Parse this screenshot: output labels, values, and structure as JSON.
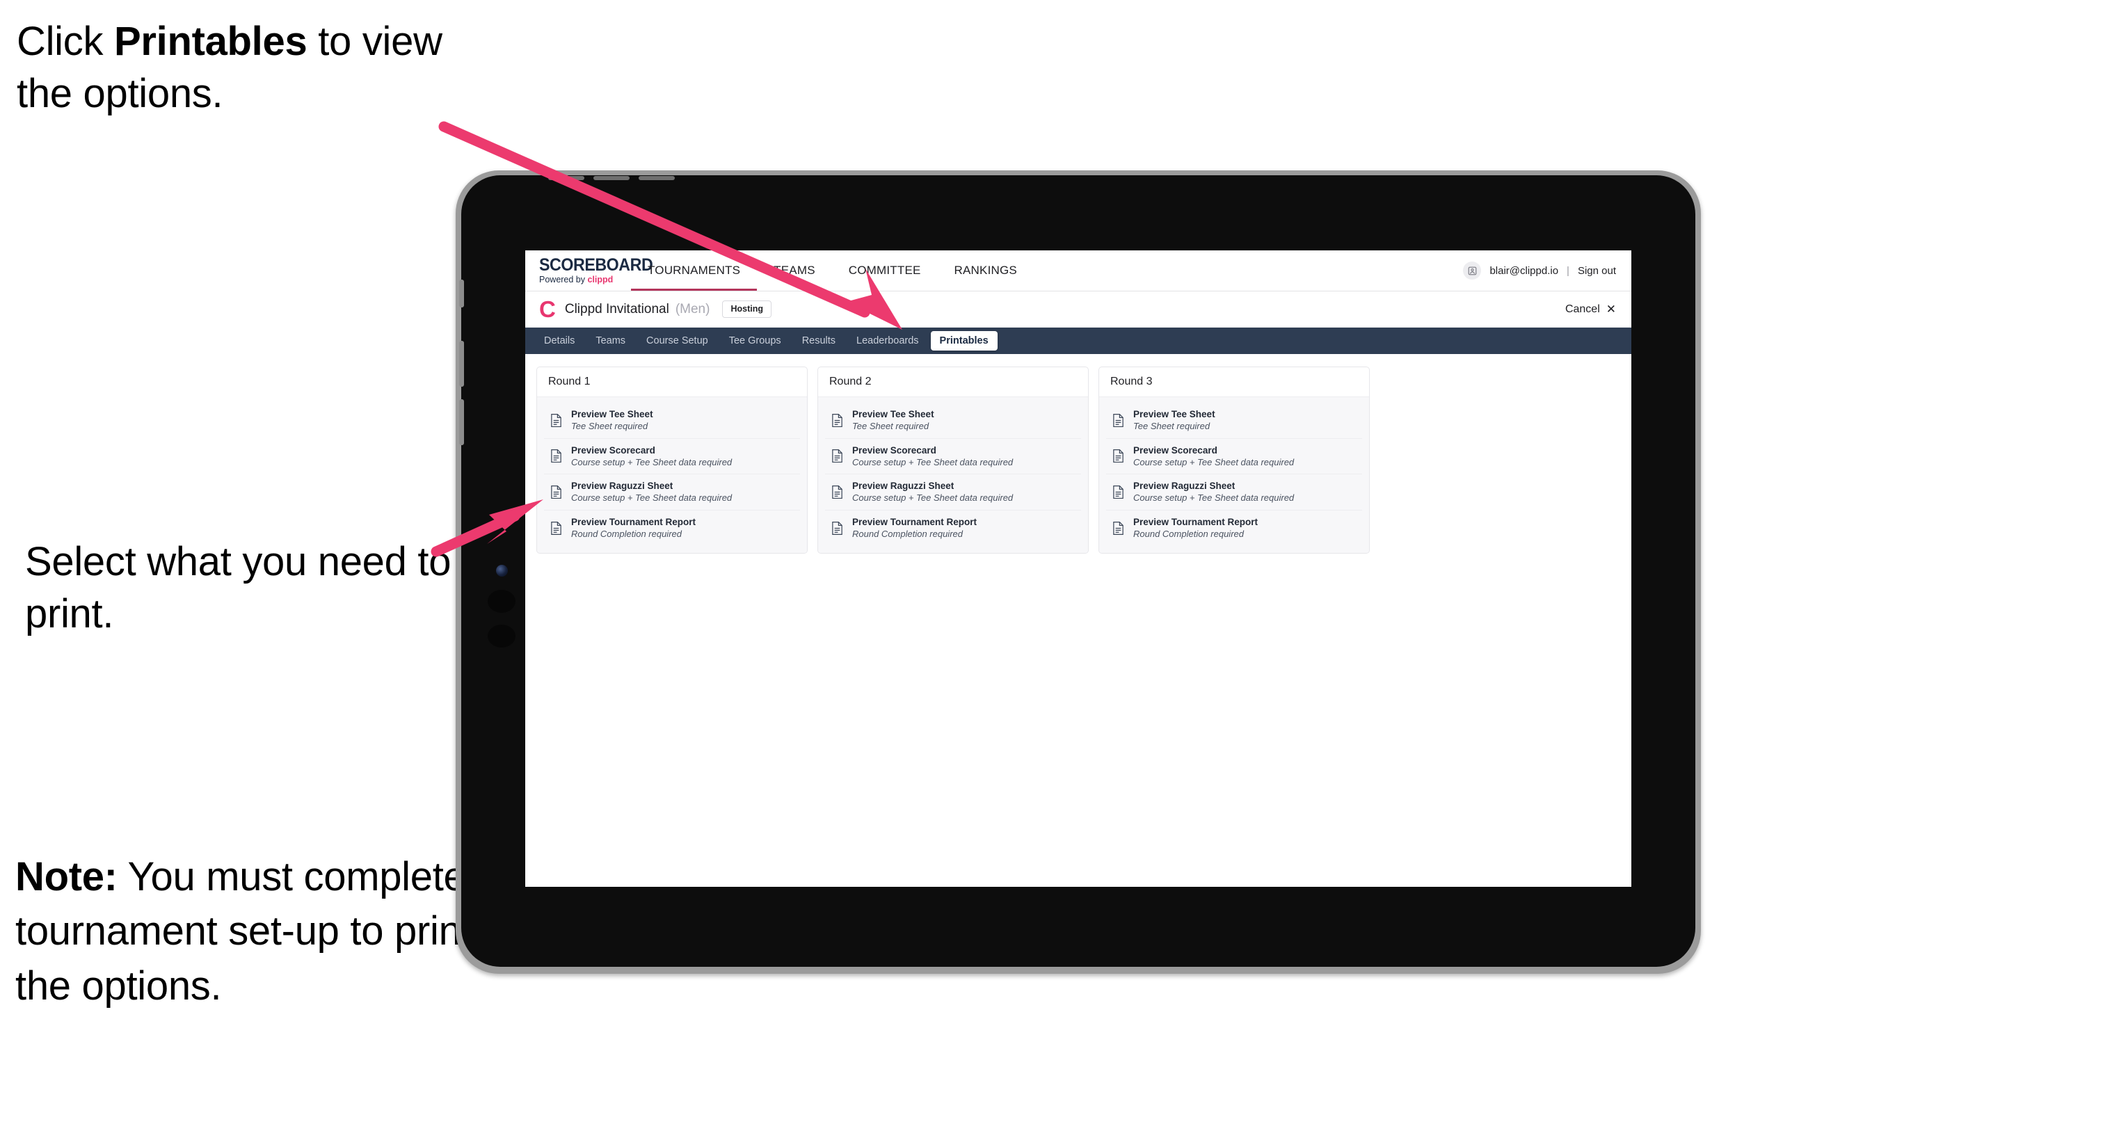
{
  "annotations": {
    "click_printables": {
      "before": "Click ",
      "bold": "Printables",
      "after": " to view the options."
    },
    "select_print": "Select what you need to print.",
    "note": {
      "bold": "Note:",
      "text": " You must complete the tournament set-up to print all the options."
    },
    "arrow_color": "#ec3a6e"
  },
  "app": {
    "brand": {
      "title": "SCOREBOARD",
      "powered_prefix": "Powered by ",
      "powered_name": "clippd"
    },
    "main_nav": [
      {
        "label": "TOURNAMENTS",
        "active": true
      },
      {
        "label": "TEAMS",
        "active": false
      },
      {
        "label": "COMMITTEE",
        "active": false
      },
      {
        "label": "RANKINGS",
        "active": false
      }
    ],
    "account": {
      "avatar_icon": "user-avatar-icon",
      "email": "blair@clippd.io",
      "separator": "|",
      "sign_out": "Sign out"
    },
    "tournament_header": {
      "logo_letter": "C",
      "name": "Clippd Invitational",
      "gender": "(Men)",
      "badge": "Hosting",
      "cancel_label": "Cancel",
      "cancel_icon": "close-icon"
    },
    "tabs": [
      {
        "label": "Details",
        "active": false
      },
      {
        "label": "Teams",
        "active": false
      },
      {
        "label": "Course Setup",
        "active": false
      },
      {
        "label": "Tee Groups",
        "active": false
      },
      {
        "label": "Results",
        "active": false
      },
      {
        "label": "Leaderboards",
        "active": false
      },
      {
        "label": "Printables",
        "active": true
      }
    ],
    "rounds": [
      {
        "title": "Round 1",
        "items": [
          {
            "icon": "document-icon",
            "title": "Preview Tee Sheet",
            "subtitle": "Tee Sheet required"
          },
          {
            "icon": "document-icon",
            "title": "Preview Scorecard",
            "subtitle": "Course setup + Tee Sheet data required"
          },
          {
            "icon": "document-icon",
            "title": "Preview Raguzzi Sheet",
            "subtitle": "Course setup + Tee Sheet data required"
          },
          {
            "icon": "document-icon",
            "title": "Preview Tournament Report",
            "subtitle": "Round Completion required"
          }
        ]
      },
      {
        "title": "Round 2",
        "items": [
          {
            "icon": "document-icon",
            "title": "Preview Tee Sheet",
            "subtitle": "Tee Sheet required"
          },
          {
            "icon": "document-icon",
            "title": "Preview Scorecard",
            "subtitle": "Course setup + Tee Sheet data required"
          },
          {
            "icon": "document-icon",
            "title": "Preview Raguzzi Sheet",
            "subtitle": "Course setup + Tee Sheet data required"
          },
          {
            "icon": "document-icon",
            "title": "Preview Tournament Report",
            "subtitle": "Round Completion required"
          }
        ]
      },
      {
        "title": "Round 3",
        "items": [
          {
            "icon": "document-icon",
            "title": "Preview Tee Sheet",
            "subtitle": "Tee Sheet required"
          },
          {
            "icon": "document-icon",
            "title": "Preview Scorecard",
            "subtitle": "Course setup + Tee Sheet data required"
          },
          {
            "icon": "document-icon",
            "title": "Preview Raguzzi Sheet",
            "subtitle": "Course setup + Tee Sheet data required"
          },
          {
            "icon": "document-icon",
            "title": "Preview Tournament Report",
            "subtitle": "Round Completion required"
          }
        ]
      }
    ],
    "colors": {
      "accent_pink": "#e8366f",
      "tabstrip_navy": "#2e3d53",
      "active_underline": "#b4365c"
    }
  }
}
